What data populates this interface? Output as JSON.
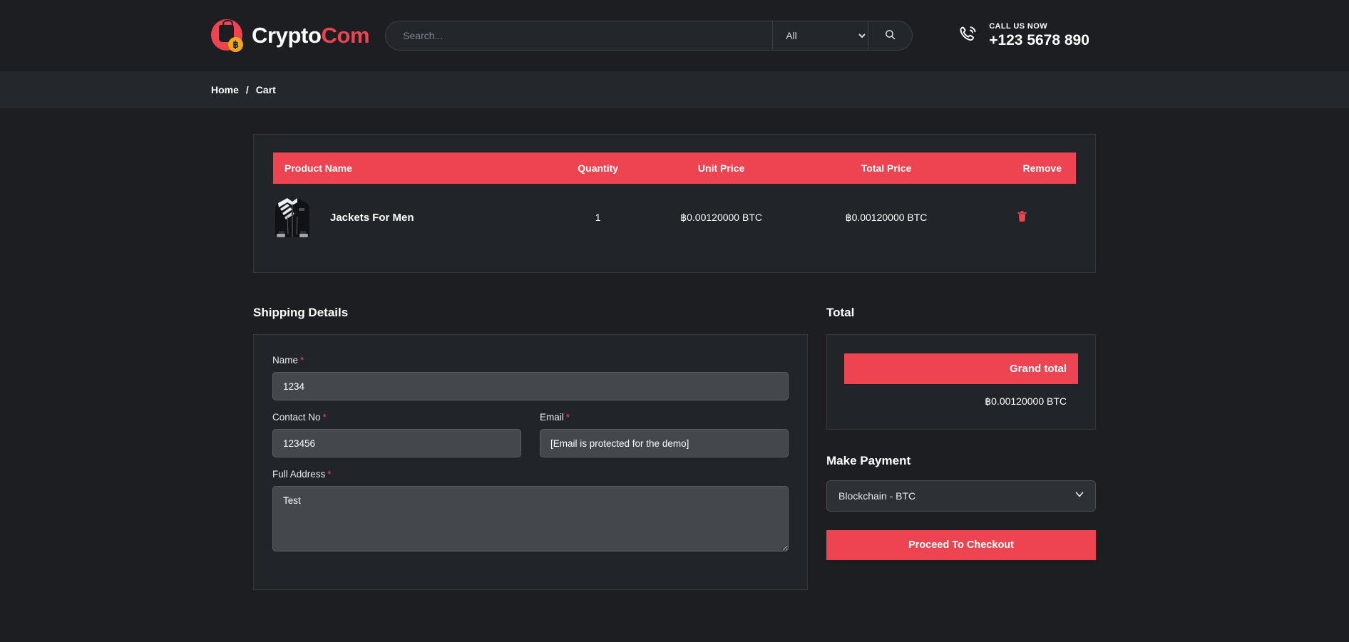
{
  "header": {
    "logo": {
      "name_part1": "Crypto",
      "name_part2": "Com",
      "coin_symbol": "฿"
    },
    "search": {
      "placeholder": "Search...",
      "value": "",
      "category_selected": "All",
      "search_icon": "search-icon"
    },
    "call": {
      "label": "CALL US NOW",
      "number": "+123 5678 890",
      "icon": "phone-ringing-icon"
    }
  },
  "breadcrumb": {
    "home": "Home",
    "separator": "/",
    "current": "Cart"
  },
  "cart": {
    "columns": [
      "Product Name",
      "Quantity",
      "Unit Price",
      "Total Price",
      "Remove"
    ],
    "rows": [
      {
        "product_name": "Jackets For Men",
        "quantity": "1",
        "unit_price": "฿0.00120000 BTC",
        "total_price": "฿0.00120000 BTC",
        "remove_icon": "trash-icon"
      }
    ]
  },
  "shipping": {
    "title": "Shipping Details",
    "name": {
      "label": "Name",
      "required": "*",
      "value": "1234",
      "placeholder": ""
    },
    "contact": {
      "label": "Contact No",
      "required": "*",
      "value": "123456",
      "placeholder": ""
    },
    "email": {
      "label": "Email",
      "required": "*",
      "value": "[Email is protected for the demo]",
      "placeholder": ""
    },
    "address": {
      "label": "Full Address",
      "required": "*",
      "value": "Test",
      "placeholder": ""
    }
  },
  "total": {
    "title": "Total",
    "grand_total_label": "Grand total",
    "grand_total_value": "฿0.00120000 BTC"
  },
  "payment": {
    "title": "Make Payment",
    "selected_method": "Blockchain - BTC",
    "options": [
      "Blockchain - BTC"
    ],
    "checkout_label": "Proceed To Checkout"
  },
  "colors": {
    "accent": "#ee4351",
    "page_bg": "#1c1e22",
    "panel_bg": "#212429",
    "breadcrumb_bg": "#24272c",
    "input_bg": "#44474c",
    "coin_gold": "#f2a71b"
  }
}
